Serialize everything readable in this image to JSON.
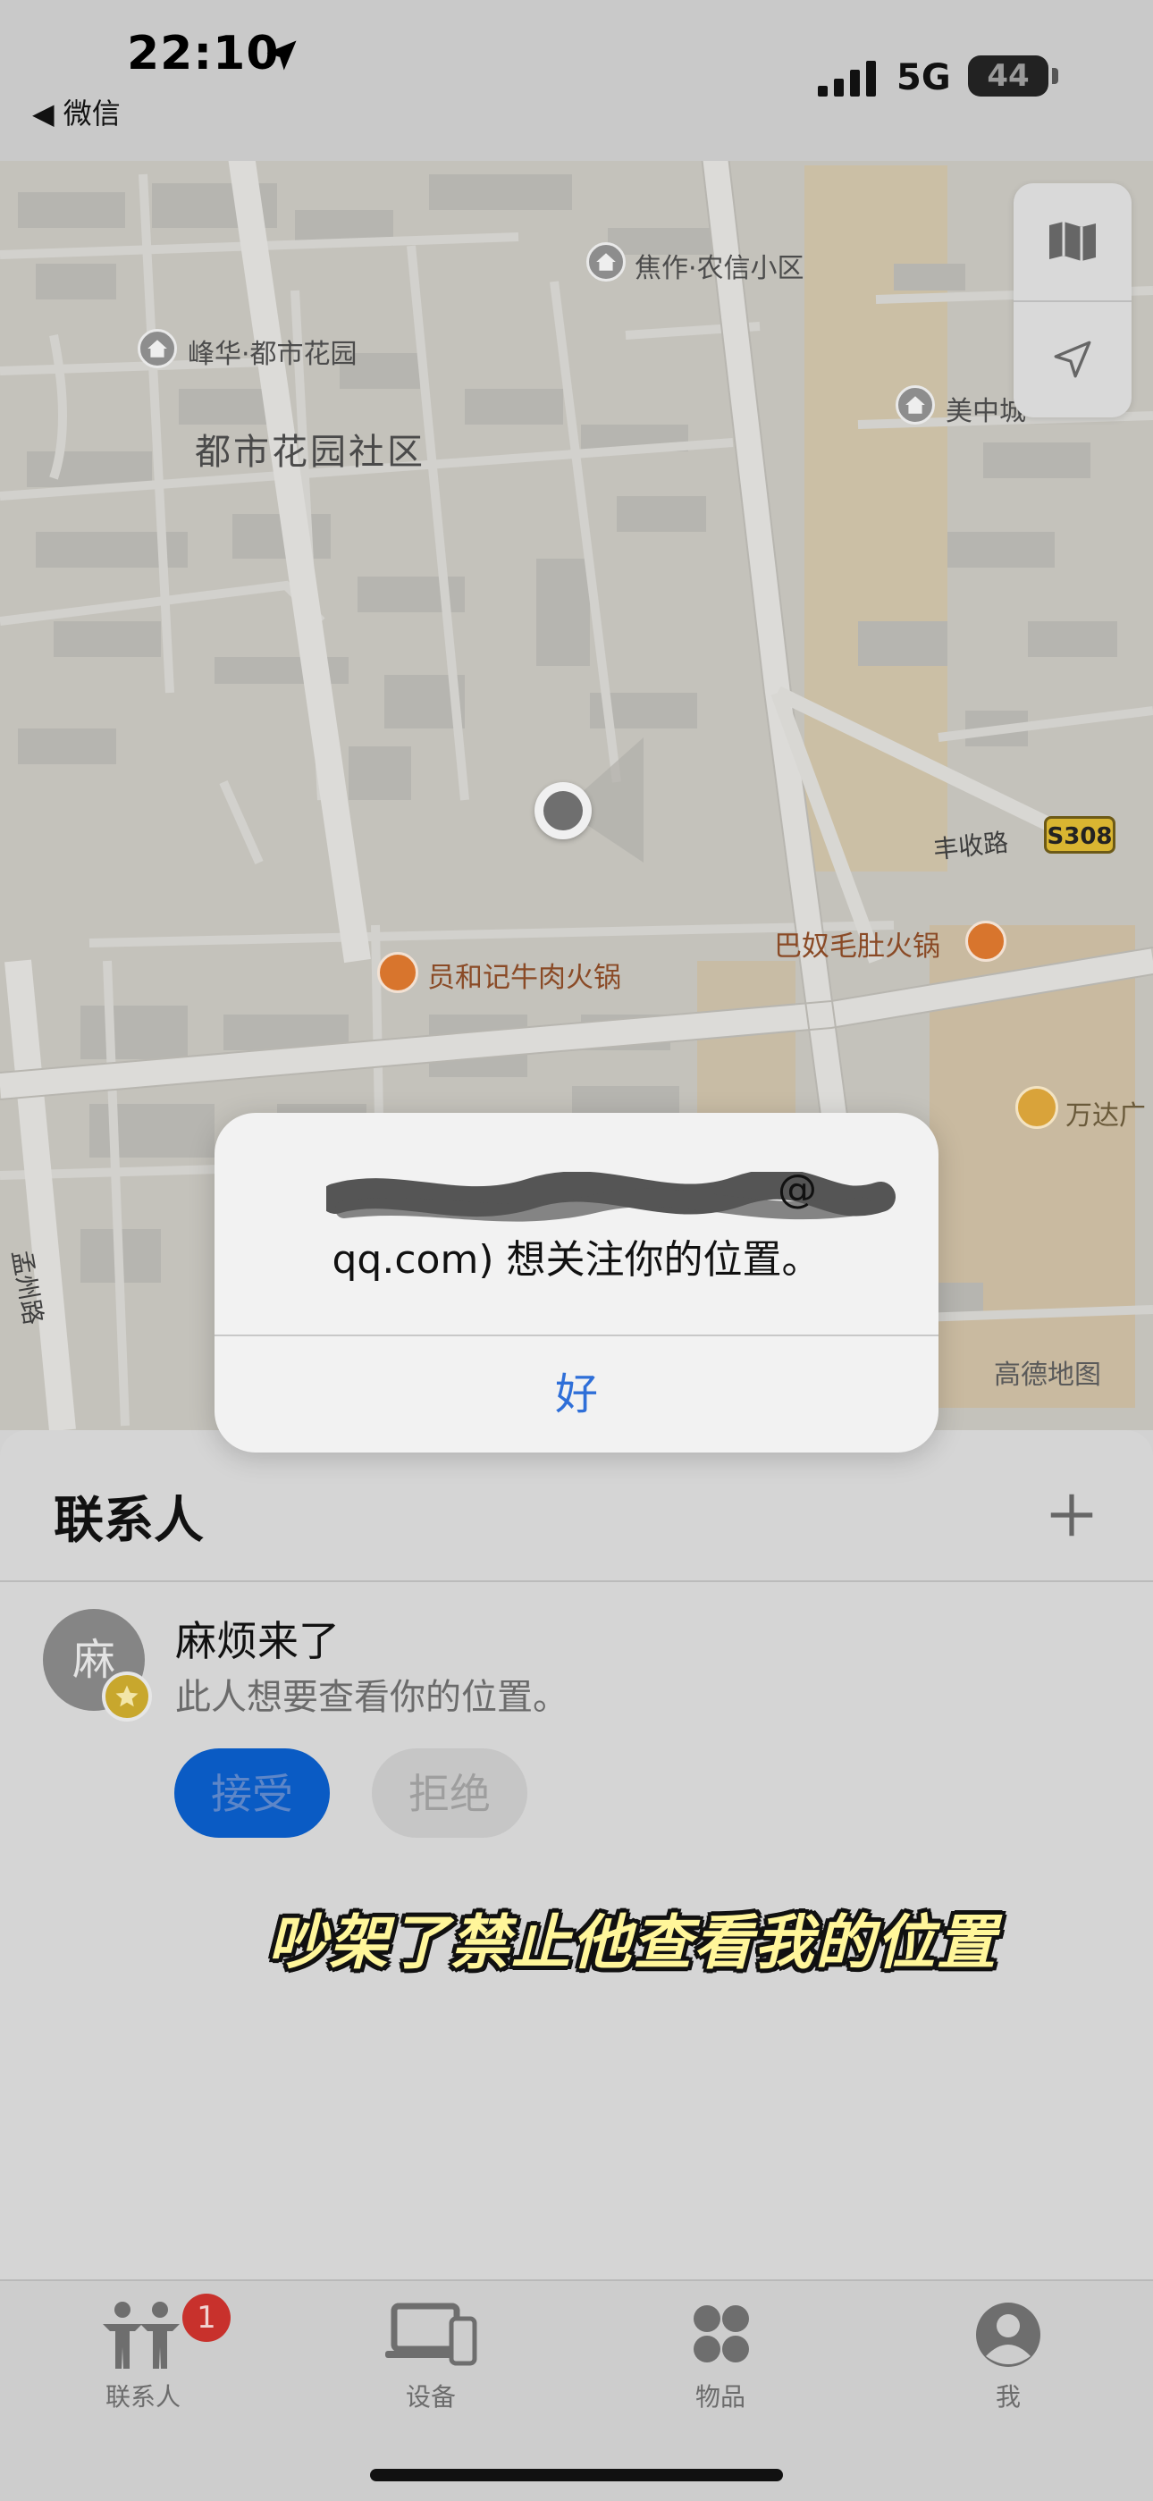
{
  "status_bar": {
    "time": "22:10",
    "back_app": "◀ 微信",
    "network": "5G",
    "battery": "44"
  },
  "map": {
    "pois": [
      {
        "label": "焦作·农信小区",
        "kind": "residential"
      },
      {
        "label": "峰华·都市花园",
        "kind": "residential"
      },
      {
        "label": "美中城",
        "kind": "residential"
      },
      {
        "label": "万达广",
        "kind": "mall"
      }
    ],
    "district": "都市花园社区",
    "roads": [
      "丰收路",
      "孟州路"
    ],
    "highway": "S308",
    "restaurants": [
      "员和记牛肉火锅",
      "巴奴毛肚火锅"
    ],
    "attribution": "高德地图",
    "controls": {
      "map_mode_icon": "map-icon",
      "locate_icon": "location-arrow-icon"
    }
  },
  "alert": {
    "line1_suffix": "@",
    "line2": "qq.com) 想关注你的位置。",
    "ok_label": "好"
  },
  "people": {
    "title": "联系人",
    "add_icon": "plus-icon",
    "contact": {
      "avatar_text": "麻",
      "name": "麻烦来了",
      "subtitle": "此人想要查看你的位置。",
      "accept_label": "接受",
      "decline_label": "拒绝"
    },
    "caption": "吵架了禁止他查看我的位置"
  },
  "tabbar": {
    "tabs": [
      {
        "label": "联系人",
        "icon": "people-icon",
        "badge": "1"
      },
      {
        "label": "设备",
        "icon": "devices-icon"
      },
      {
        "label": "物品",
        "icon": "items-icon"
      },
      {
        "label": "我",
        "icon": "me-icon"
      }
    ]
  },
  "colors": {
    "accent": "#0a5bc4",
    "alert_button": "#2f6fd8",
    "badge": "#c8312c",
    "caption": "#fff69a"
  }
}
